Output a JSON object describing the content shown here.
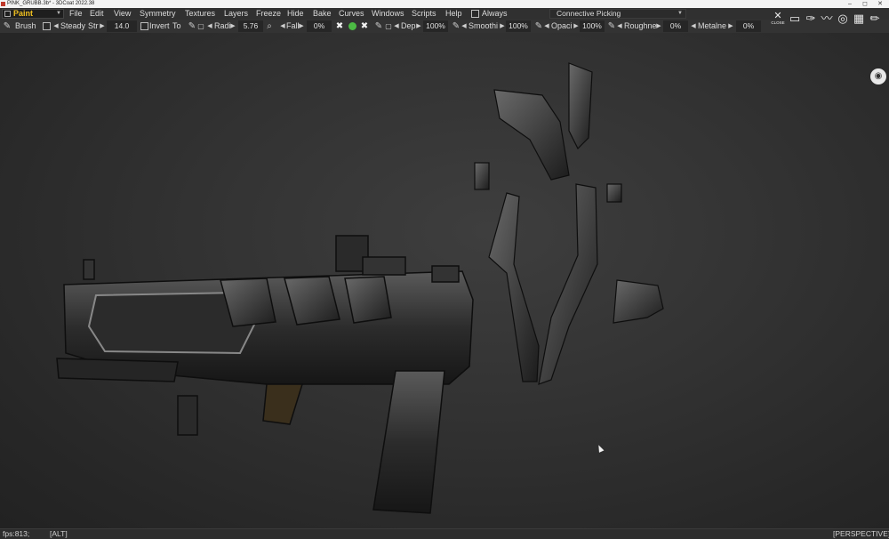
{
  "window": {
    "title": "PINK_GRUBB.3b* - 3DCoat 2022.38",
    "controls": {
      "minimize": "–",
      "maximize": "◻",
      "close": "✕"
    }
  },
  "menubar": {
    "room": "Paint",
    "menus": [
      "File",
      "Edit",
      "View",
      "Symmetry",
      "Textures",
      "Layers",
      "Freeze",
      "Hide",
      "Bake",
      "Curves",
      "Windows",
      "Scripts",
      "Help"
    ],
    "always_label": "Always",
    "picking_mode": "Connective  Picking"
  },
  "toolbar": {
    "brush_label": "Brush",
    "steady_label": "Steady",
    "str_label": "Str",
    "str_value": "14.0",
    "invert_label": "Invert",
    "to_label": "To",
    "radius_label": "Radi",
    "radius_value": "5.76",
    "falloff_label": "Fall",
    "falloff_value": "0%",
    "depth_label": "Dep",
    "depth_value": "100%",
    "smooth_label": "Smoothi",
    "smooth_value": "100%",
    "opacity_label": "Opaci",
    "opacity_value": "100%",
    "roughness_label": "Roughne",
    "roughness_value": "0%",
    "metalness_label": "Metalne",
    "metalness_value": "0%"
  },
  "tools_right": {
    "close_label": "CLOSE"
  },
  "statusbar": {
    "fps": "fps:813;",
    "modifier": "[ALT]",
    "projection": "[PERSPECTIVE]"
  },
  "colors": {
    "room_accent": "#f0c020",
    "active_green": "#4cbb44",
    "viewport_bg": "#333333",
    "ui_bg": "#303030"
  }
}
